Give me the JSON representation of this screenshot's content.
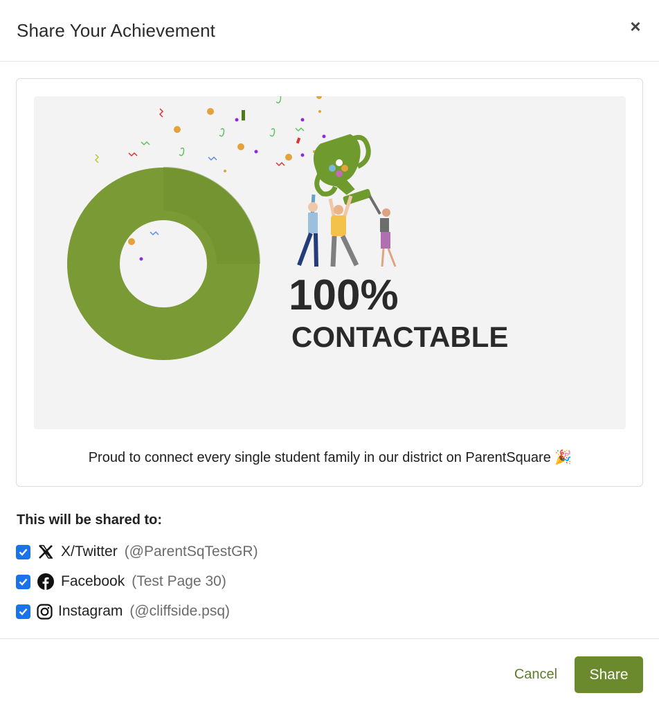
{
  "modal": {
    "title": "Share Your Achievement",
    "close_label": "×"
  },
  "achievement": {
    "big_text": "100%",
    "sub_text": "CONTACTABLE",
    "caption": "Proud to connect every single student family in our district on ParentSquare 🎉",
    "donut_percent": 100,
    "colors": {
      "donut_primary": "#7a9a35",
      "donut_secondary": "#6f8f2f",
      "trophy": "#6f9a2e",
      "panel_bg": "#f3f3f3"
    }
  },
  "share": {
    "heading": "This will be shared to:",
    "targets": [
      {
        "platform": "X/Twitter",
        "handle": "(@ParentSqTestGR)",
        "checked": true,
        "icon": "x-logo-icon"
      },
      {
        "platform": "Facebook",
        "handle": "(Test Page 30)",
        "checked": true,
        "icon": "facebook-icon"
      },
      {
        "platform": "Instagram",
        "handle": "(@cliffside.psq)",
        "checked": true,
        "icon": "instagram-icon"
      }
    ]
  },
  "footer": {
    "cancel_label": "Cancel",
    "share_label": "Share",
    "colors": {
      "primary": "#6b8a2e",
      "cancel_text": "#5c7c2a",
      "checkbox": "#1a73e8"
    }
  }
}
